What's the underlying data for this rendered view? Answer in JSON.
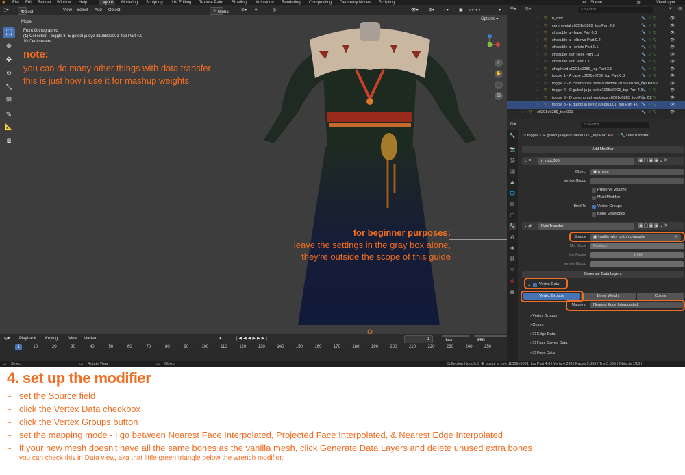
{
  "menu": {
    "items": [
      "File",
      "Edit",
      "Render",
      "Window",
      "Help"
    ],
    "workspaces": [
      "Layout",
      "Modeling",
      "Sculpting",
      "UV Editing",
      "Texture Paint",
      "Shading",
      "Animation",
      "Rendering",
      "Compositing",
      "Geometry Nodes",
      "Scripting"
    ],
    "active_workspace": "Layout",
    "scene_label": "Scene",
    "view_layer_label": "ViewLayer"
  },
  "viewport": {
    "mode": "Object Mode",
    "menus": [
      "View",
      "Select",
      "Add",
      "Object"
    ],
    "transform_orientation": "Global",
    "options_label": "Options",
    "info_view": "Front Orthographic",
    "info_collection": "(1) Collection | toggle 3 -E gulool ja eye d1068e0001_top Part 4.0",
    "info_scale": "10 Centimeters",
    "note_title": "note:",
    "note_line1": "you can do many other things with data  transfer",
    "note_line2": "this is just how i use it for mashup weights",
    "beginner_title": "for beginner purposes:",
    "beginner_line1": "leave the settings in the gray box alone,",
    "beginner_line2": "they're outside the scope of this guide"
  },
  "timeline": {
    "menus": [
      "Playback",
      "Keying",
      "View",
      "Marker"
    ],
    "current_frame": "1",
    "start_label": "Start",
    "start": "1",
    "end_label": "End",
    "end": "250",
    "ticks": [
      "1",
      "10",
      "20",
      "30",
      "40",
      "50",
      "60",
      "70",
      "80",
      "90",
      "100",
      "110",
      "120",
      "130",
      "140",
      "150",
      "160",
      "170",
      "180",
      "190",
      "200",
      "210",
      "220",
      "230",
      "240",
      "250"
    ]
  },
  "statusbar": {
    "select": "Select",
    "rotate": "Rotate View",
    "object": "Object",
    "stats": "Collection | toggle 3 -E gulool ja eye d1068e0001_top Part 4.0 | Verts:4,093 | Faces:5,865 | Tris:5,865 | Objects:1/18 |"
  },
  "outliner": {
    "search_placeholder": "Search",
    "rows": [
      {
        "label": "n_root",
        "selected": false
      },
      {
        "label": "ceremonial c0201e0289_top Part 2.0",
        "selected": false
      },
      {
        "label": "chasuble a - base Part 0.0",
        "selected": false
      },
      {
        "label": "chasuble a - elbows Part 0.2",
        "selected": false
      },
      {
        "label": "chasuble a - wrists Part 0.1",
        "selected": false
      },
      {
        "label": "chasuble skin neck Part 1.0",
        "selected": false
      },
      {
        "label": "chasuble skin Part 1.1",
        "selected": false
      },
      {
        "label": "shepherd c0201e0289_top Part 3.0",
        "selected": false
      },
      {
        "label": "toggle 1 - A cape c0201e0289_top Part 0.3",
        "selected": false
      },
      {
        "label": "toggle 2 - B ceremonial belts c0middle c0201e0289_top Part 2.1",
        "selected": false
      },
      {
        "label": "toggle 2 - C gulool ja ja belt d1068e0001_top Part 4.1",
        "selected": false
      },
      {
        "label": "toggle 3 - D ceremonial necklace c0201e0883_top Part 2.2",
        "selected": false
      },
      {
        "label": "toggle 3 - E gulool ja eye d1068e0001_top Part 4.0",
        "selected": true
      },
      {
        "label": "c0201e0289_top.001",
        "selected": false
      }
    ]
  },
  "properties": {
    "search_placeholder": "Search",
    "breadcrumb_object": "toggle 3 -E gulool ja eye d1068e0001_top Part 4.0",
    "breadcrumb_modifier": "DataTransfer",
    "add_modifier": "Add Modifier",
    "armature": {
      "name": "n_root.005",
      "object_label": "Object",
      "object_value": "n_root",
      "vertex_group_label": "Vertex Group",
      "preserve_volume": "Preserve Volume",
      "multi_modifier": "Multi Modifier",
      "bind_to_label": "Bind To",
      "vertex_groups": "Vertex Groups",
      "bone_envelopes": "Bone Envelopes"
    },
    "datatransfer": {
      "name": "DataTransfer",
      "source_label": "Source",
      "source_value": "vanilla ruby cotton chasuble",
      "mix_mode_label": "Mix Mode",
      "mix_mode_value": "Replace",
      "mix_factor_label": "Mix Factor",
      "mix_factor_value": "1.000",
      "vertex_group_label": "Vertex Group",
      "generate_layers": "Generate Data Layers",
      "vertex_data": "Vertex Data",
      "btn_vertex_groups": "Vertex Groups",
      "btn_bevel_weight": "Bevel Weight",
      "btn_colors": "Colors",
      "mapping_label": "Mapping",
      "mapping_value": "Nearest Edge Interpolated",
      "sub_vertex_groups": "Vertex Groups",
      "sub_colors": "Colors",
      "edge_data": "Edge Data",
      "face_corner_data": "Face Corner Data",
      "face_data": "Face Data"
    }
  },
  "caption": {
    "title": "4. set up the modifier",
    "steps": [
      "set the Source field",
      "click the Vertex Data checkbox",
      "click the Vertex Groups button",
      "set the mapping mode - i go between Nearest  Face Interpolated, Projected Face Interpolated, & Nearest Edge Interpolated",
      "if your new mesh doesn't have all the same bones as the vanilla mesh, click Generate Data Layers and delete unused extra bones"
    ],
    "step5_sub": "you can check this  in Data view, aka that little green triangle below the wrench modifier."
  },
  "colors": {
    "accent": "#f26d21",
    "blender_blue": "#4772b3",
    "viewport_bg": "#3d3d3d",
    "panel_bg": "#2c2c2c"
  }
}
